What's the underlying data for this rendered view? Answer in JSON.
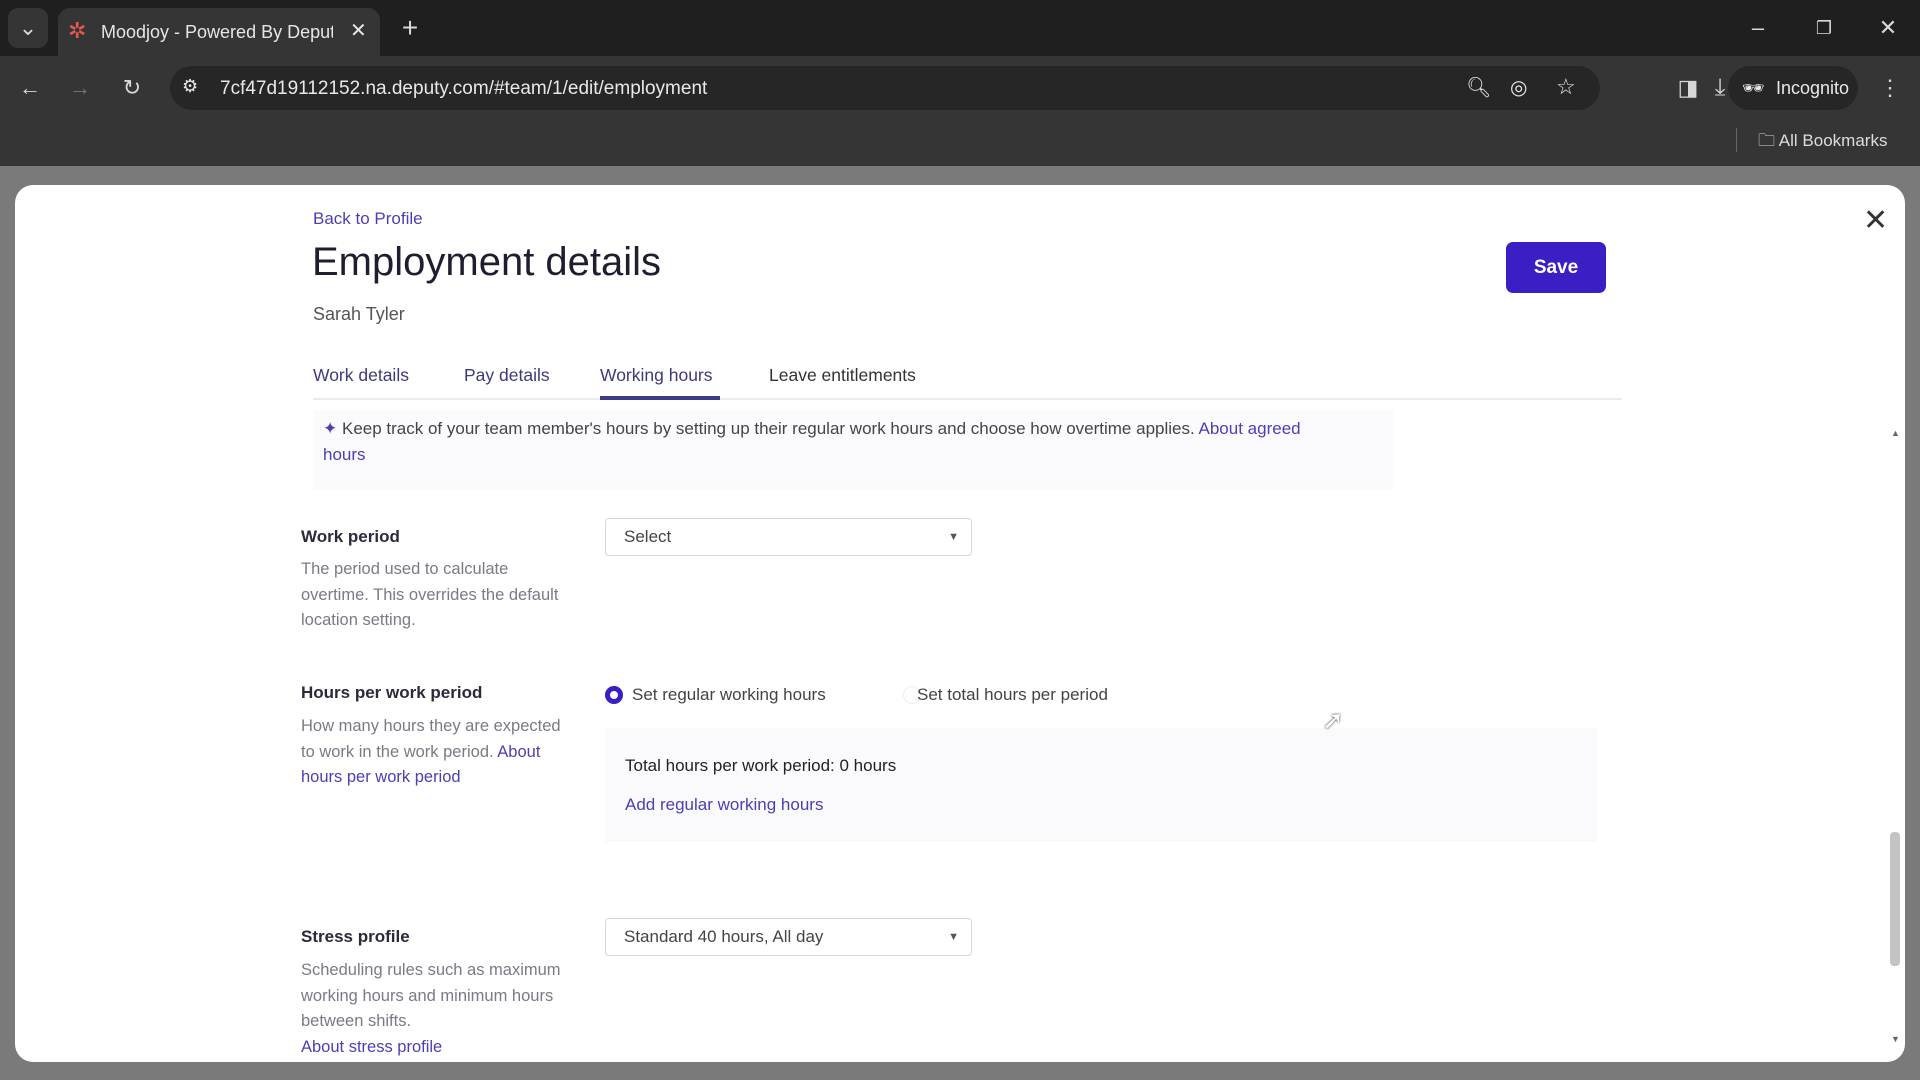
{
  "browser": {
    "tab_title": "Moodjoy - Powered By Deputy",
    "url": "7cf47d19112152.na.deputy.com/#team/1/edit/employment",
    "incognito": "Incognito",
    "bookmarks": "All Bookmarks"
  },
  "page": {
    "back_link": "Back to Profile",
    "title": "Employment details",
    "employee": "Sarah Tyler",
    "save": "Save",
    "tabs": [
      {
        "label": "Work details"
      },
      {
        "label": "Pay details"
      },
      {
        "label": "Working hours",
        "active": true
      },
      {
        "label": "Leave entitlements"
      }
    ],
    "info": {
      "text": "Keep track of your team member's hours by setting up their regular work hours and choose how overtime applies.",
      "link1": "About agreed",
      "link2": "hours"
    },
    "work_period": {
      "label": "Work period",
      "desc": "The period used to calculate overtime. This overrides the default location setting.",
      "value": "Select"
    },
    "hours": {
      "label": "Hours per work period",
      "desc": "How many hours they are expected to work in the work period.",
      "link": "About hours per work period",
      "option1": "Set regular working hours",
      "option2": "Set total hours per period",
      "total": "Total hours per work period: 0 hours",
      "add": "Add regular working hours"
    },
    "stress": {
      "label": "Stress profile",
      "desc": "Scheduling rules such as maximum working hours and minimum hours between shifts.",
      "link": "About stress profile",
      "value": "Standard 40 hours, All day"
    }
  },
  "colors": {
    "accent": "#3b1fc4",
    "link": "#4b3fb4"
  }
}
